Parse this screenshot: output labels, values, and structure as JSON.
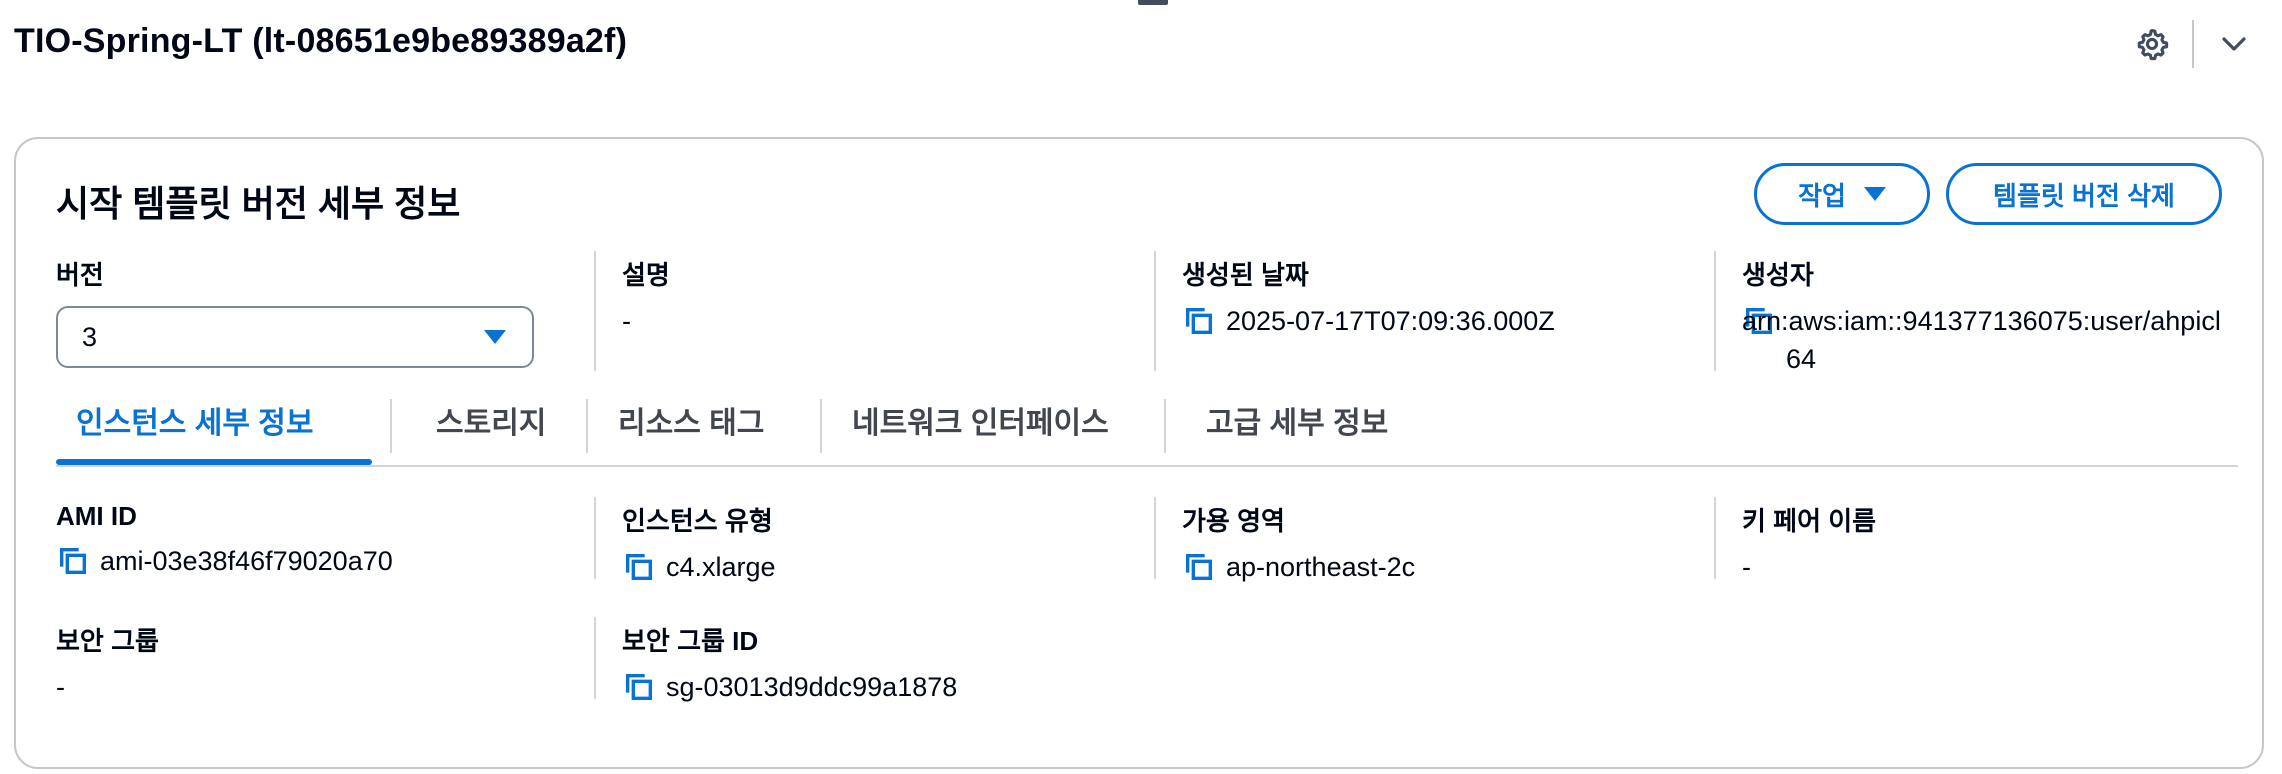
{
  "page": {
    "title": "TIO-Spring-LT (lt-08651e9be89389a2f)",
    "header_icons": [
      "gear-icon",
      "chevron-down-icon"
    ]
  },
  "card": {
    "title": "시작 템플릿 버전 세부 정보",
    "actions_button": "작업",
    "delete_button": "템플릿 버전 삭제"
  },
  "summary": {
    "version": {
      "label": "버전",
      "value": "3"
    },
    "description": {
      "label": "설명",
      "value": "-"
    },
    "created_date": {
      "label": "생성된 날짜",
      "value": "2025-07-17T07:09:36.000Z"
    },
    "created_by": {
      "label": "생성자",
      "value": "arn:aws:iam::941377136075:user/ahpicl64"
    }
  },
  "tabs": [
    {
      "label": "인스턴스 세부 정보",
      "active": true
    },
    {
      "label": "스토리지",
      "active": false
    },
    {
      "label": "리소스 태그",
      "active": false
    },
    {
      "label": "네트워크 인터페이스",
      "active": false
    },
    {
      "label": "고급 세부 정보",
      "active": false
    }
  ],
  "details": {
    "ami_id": {
      "label": "AMI ID",
      "value": "ami-03e38f46f79020a70"
    },
    "instance_type": {
      "label": "인스턴스 유형",
      "value": "c4.xlarge"
    },
    "availability_zone": {
      "label": "가용 영역",
      "value": "ap-northeast-2c"
    },
    "key_pair": {
      "label": "키 페어 이름",
      "value": "-"
    },
    "security_group": {
      "label": "보안 그룹",
      "value": "-"
    },
    "security_group_id": {
      "label": "보안 그룹 ID",
      "value": "sg-03013d9ddc99a1878"
    }
  },
  "colors": {
    "accent": "#0972d3",
    "text": "#000716",
    "border": "#c6c6cd"
  }
}
